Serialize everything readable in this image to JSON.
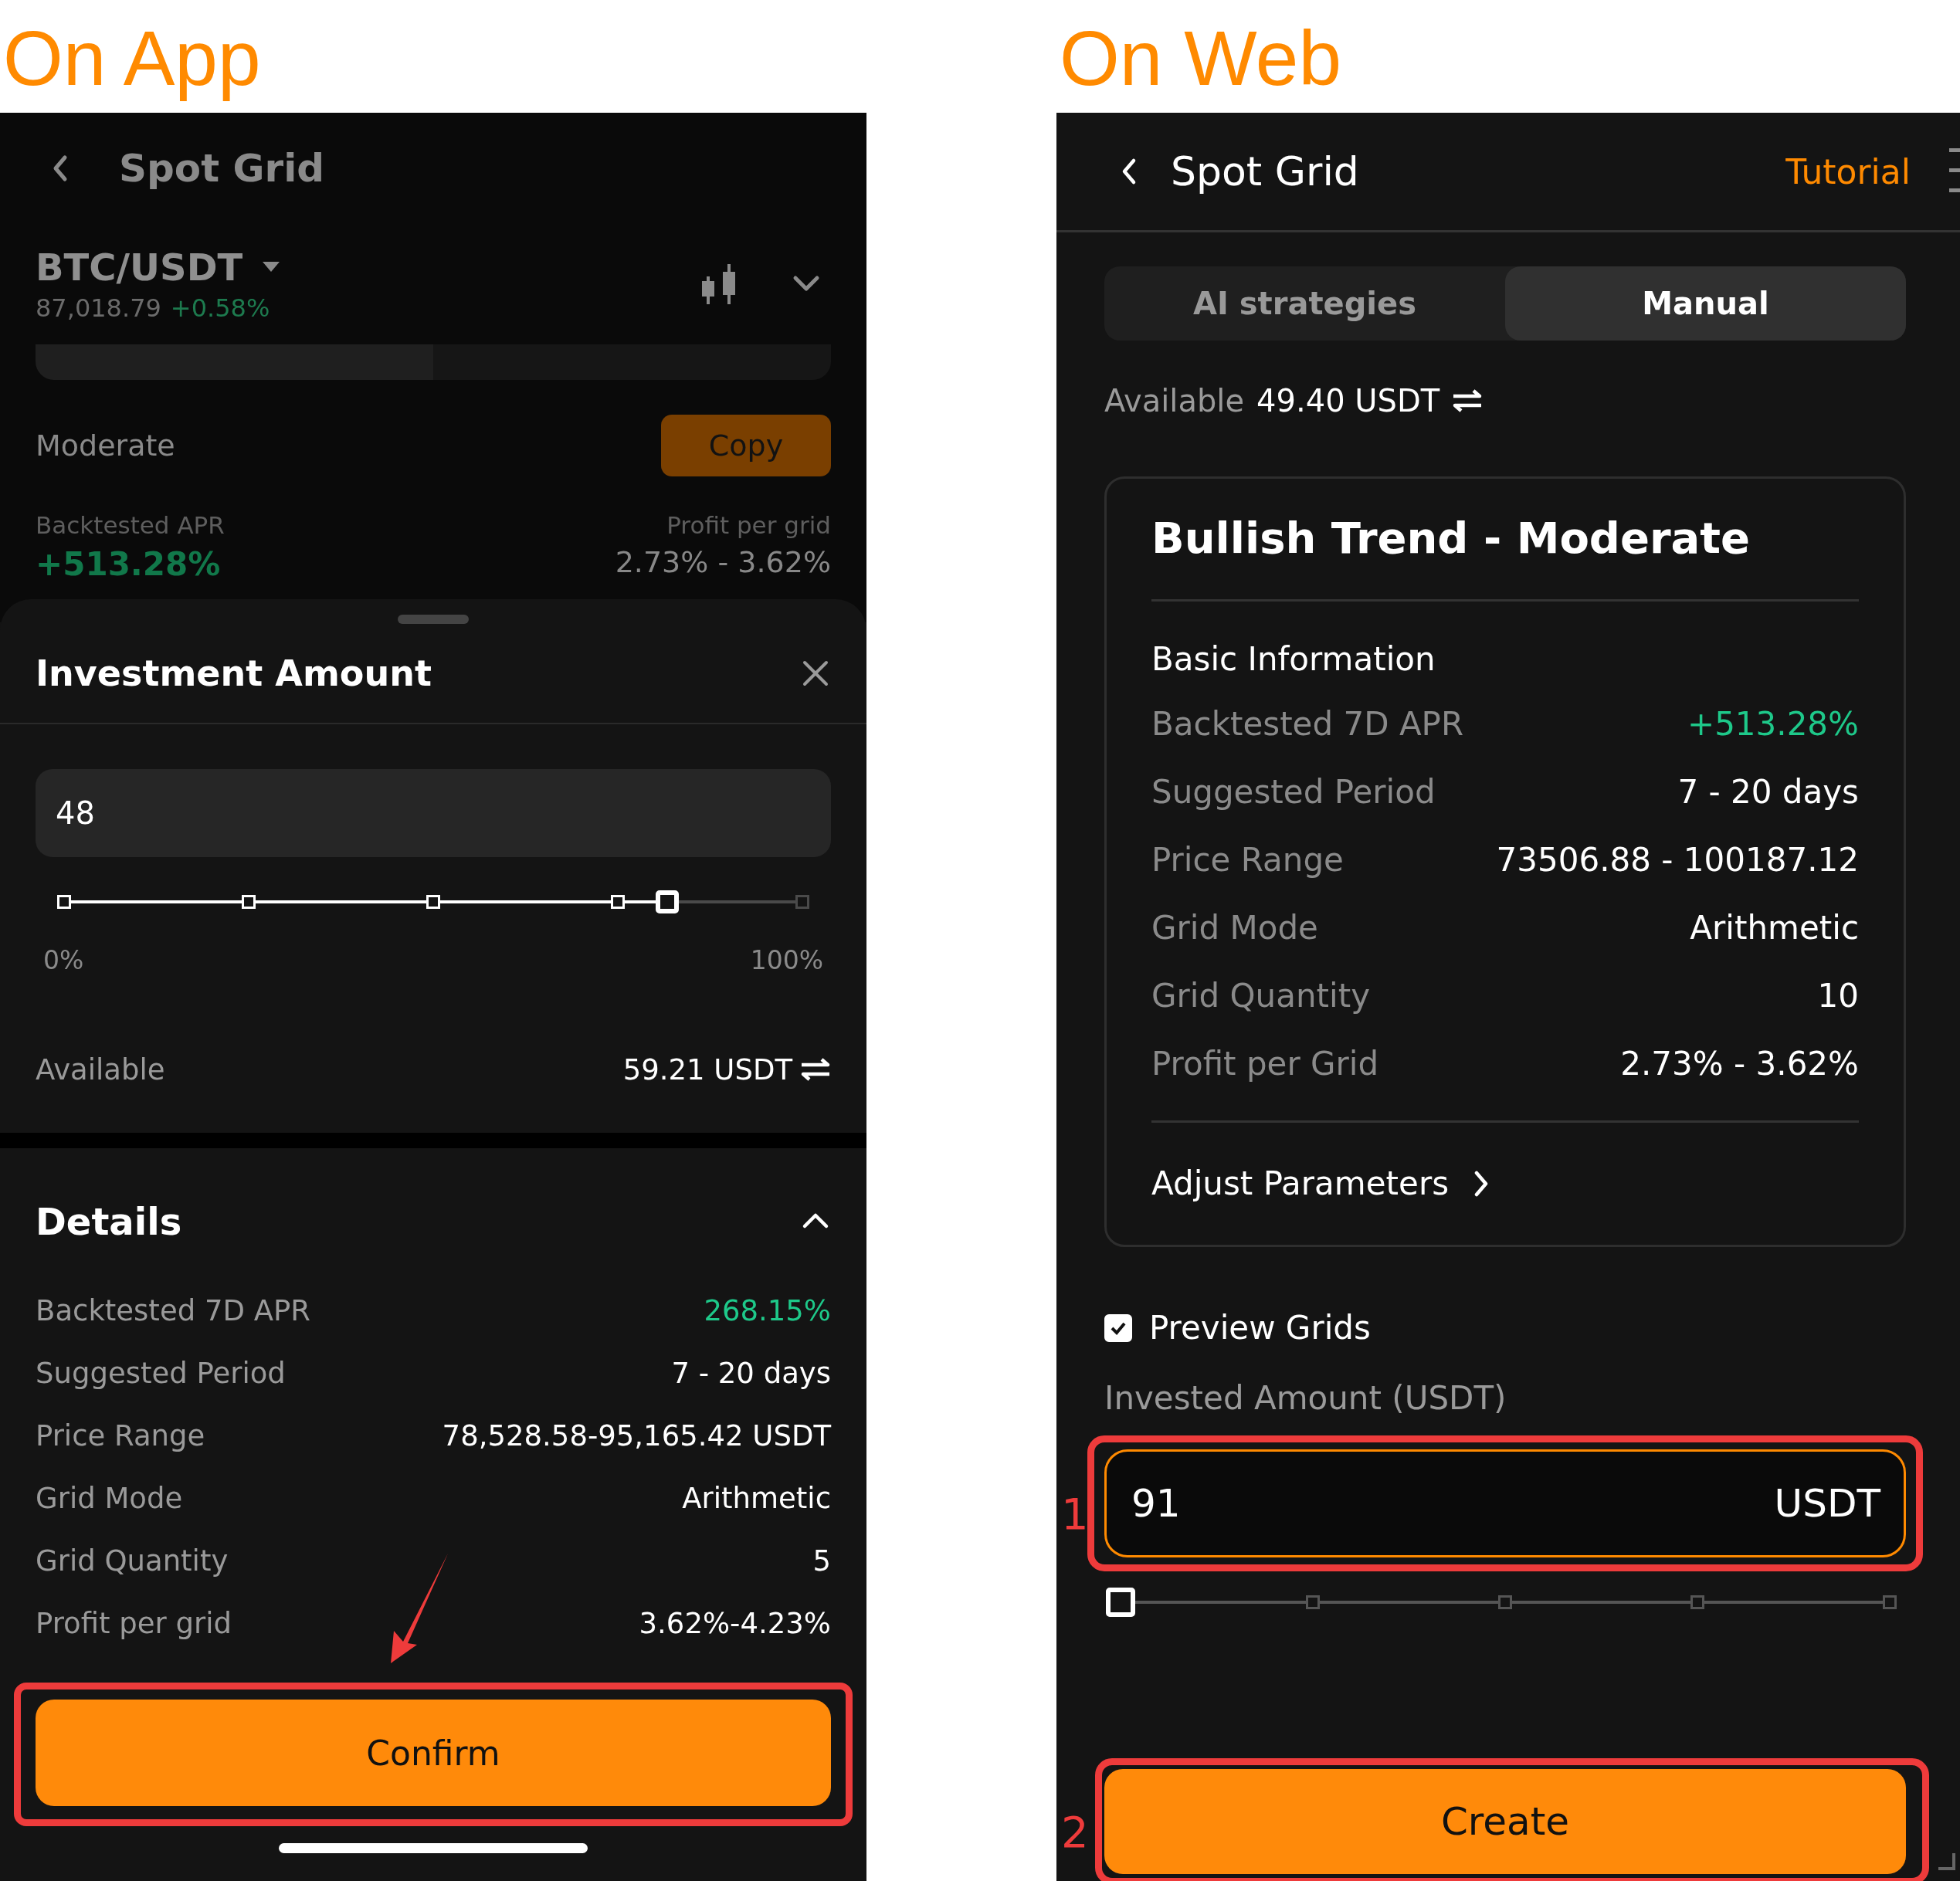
{
  "app": {
    "heading": "On App",
    "header": {
      "title": "Spot Grid"
    },
    "pair": {
      "symbol": "BTC/USDT",
      "price": "87,018.79",
      "change": "+0.58%"
    },
    "strategy": {
      "name": "Moderate",
      "copy_button": "Copy"
    },
    "stats": [
      {
        "label": "Backtested APR",
        "value": "+513.28%",
        "positive": true
      },
      {
        "label": "Profit per grid",
        "value": "2.73% - 3.62%",
        "positive": false
      }
    ],
    "sheet": {
      "title": "Investment Amount",
      "amount": "48",
      "slider": {
        "level": 0.817
      },
      "min_label": "0%",
      "max_label": "100%",
      "available_label": "Available",
      "available_value": "59.21 USDT"
    },
    "details": {
      "title": "Details",
      "expanded": true,
      "rows": [
        {
          "label": "Backtested 7D APR",
          "value": "268.15%",
          "positive": true
        },
        {
          "label": "Suggested Period",
          "value": "7 - 20 days",
          "positive": false
        },
        {
          "label": "Price Range",
          "value": "78,528.58-95,165.42 USDT",
          "positive": false
        },
        {
          "label": "Grid Mode",
          "value": "Arithmetic",
          "positive": false
        },
        {
          "label": "Grid Quantity",
          "value": "5",
          "positive": false
        },
        {
          "label": "Profit per grid",
          "value": "3.62%-4.23%",
          "positive": false
        }
      ]
    },
    "confirm_button": {
      "label": "Confirm",
      "highlighted": true
    }
  },
  "web": {
    "heading": "On Web",
    "header": {
      "title": "Spot Grid",
      "tutorial_link": "Tutorial"
    },
    "tabs": [
      {
        "label": "AI strategies",
        "selected": false
      },
      {
        "label": "Manual",
        "selected": true
      }
    ],
    "available": {
      "label": "Available",
      "value": "49.40 USDT"
    },
    "card": {
      "title": "Bullish Trend - Moderate",
      "section": "Basic Information",
      "rows": [
        {
          "label": "Backtested 7D APR",
          "value": "+513.28%",
          "positive": true
        },
        {
          "label": "Suggested Period",
          "value": "7 - 20 days",
          "positive": false
        },
        {
          "label": "Price Range",
          "value": "73506.88 - 100187.12",
          "positive": false
        },
        {
          "label": "Grid Mode",
          "value": "Arithmetic",
          "positive": false
        },
        {
          "label": "Grid Quantity",
          "value": "10",
          "positive": false
        },
        {
          "label": "Profit per Grid",
          "value": "2.73% - 3.62%",
          "positive": false
        }
      ],
      "adjust_link": "Adjust Parameters"
    },
    "preview_grids": {
      "label": "Preview Grids",
      "checked": true
    },
    "invest": {
      "label": "Invested Amount (USDT)",
      "value": "91",
      "unit": "USDT",
      "callout": "1",
      "slider": {
        "level": 0
      }
    },
    "create_button": {
      "label": "Create",
      "callout": "2"
    }
  }
}
